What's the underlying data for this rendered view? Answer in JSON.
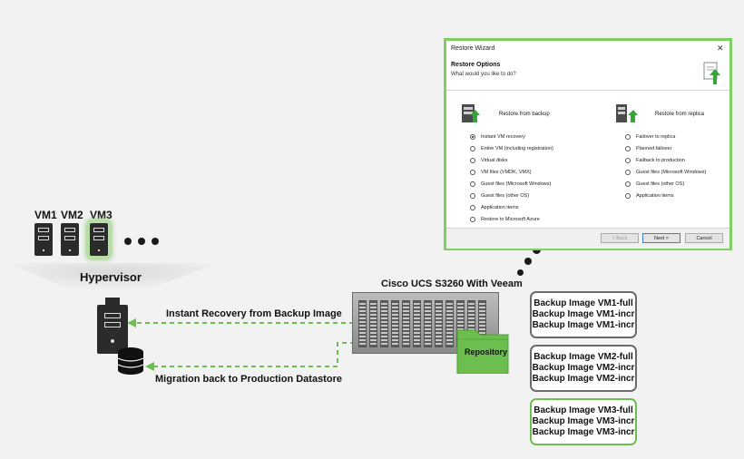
{
  "vms": [
    {
      "label": "VM1",
      "highlighted": false
    },
    {
      "label": "VM2",
      "highlighted": false
    },
    {
      "label": "VM3",
      "highlighted": true
    }
  ],
  "hypervisor": {
    "label": "Hypervisor"
  },
  "flows": {
    "instant_recovery": "Instant Recovery from Backup Image",
    "migration": "Migration back to Production Datastore"
  },
  "appliance": {
    "title": "Cisco UCS S3260 With Veeam"
  },
  "repository": {
    "label": "Repository"
  },
  "backups": [
    {
      "lines": [
        "Backup Image VM1-full",
        "Backup Image VM1-incr",
        "Backup Image VM1-incr"
      ],
      "highlighted": false
    },
    {
      "lines": [
        "Backup Image VM2-full",
        "Backup Image VM2-incr",
        "Backup Image VM2-incr"
      ],
      "highlighted": false
    },
    {
      "lines": [
        "Backup Image VM3-full",
        "Backup Image VM3-incr",
        "Backup Image VM3-incr"
      ],
      "highlighted": true
    }
  ],
  "wizard": {
    "title": "Restore Wizard",
    "close": "✕",
    "heading": "Restore Options",
    "subheading": "What would you like to do?",
    "left_title": "Restore from backup",
    "right_title": "Restore from replica",
    "left_options": [
      "Instant VM recovery",
      "Entire VM (including registration)",
      "Virtual disks",
      "VM files (VMDK, VMX)",
      "Guest files (Microsoft Windows)",
      "Guest files (other OS)",
      "Application items",
      "Restore to Microsoft Azure"
    ],
    "right_options": [
      "Failover to replica",
      "Planned failover",
      "Failback to production",
      "Guest files (Microsoft Windows)",
      "Guest files (other OS)",
      "Application items"
    ],
    "selected_left": 0,
    "buttons": {
      "back": "< Back",
      "next": "Next >",
      "cancel": "Cancel"
    }
  },
  "colors": {
    "green": "#6cbf4e",
    "dark": "#2b2b2b",
    "gray_border": "#6b6b6b"
  },
  "icons": [
    "server-icon",
    "database-icon",
    "folder-icon",
    "restore-icon",
    "radio-icon"
  ]
}
